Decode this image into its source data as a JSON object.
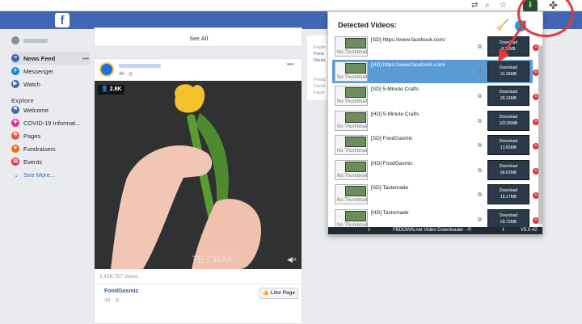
{
  "browser": {
    "ext_icon": "download-arrow-icon",
    "puzzle_icon": "puzzle-icon"
  },
  "facebook": {
    "logo": "f",
    "nav": [
      {
        "label": "News Feed",
        "icon": "newsfeed-icon",
        "color": "#4267b2"
      },
      {
        "label": "Messenger",
        "icon": "messenger-icon",
        "color": "#0084ff"
      },
      {
        "label": "Watch",
        "icon": "watch-icon",
        "color": "#4267b2"
      }
    ],
    "explore_label": "Explore",
    "explore": [
      {
        "label": "Welcome",
        "icon": "flag-icon",
        "color": "#4267b2"
      },
      {
        "label": "COVID-19 Informat...",
        "icon": "covid-icon",
        "color": "#d63384"
      },
      {
        "label": "Pages",
        "icon": "pages-icon",
        "color": "#f5533d"
      },
      {
        "label": "Fundraisers",
        "icon": "fundraisers-icon",
        "color": "#e76f1e"
      },
      {
        "label": "Events",
        "icon": "events-icon",
        "color": "#e41e3f"
      }
    ],
    "see_more": "See More...",
    "see_all": "See All",
    "post_time": "4h",
    "viewers": "2.8K",
    "watermark": "TE CRAF",
    "views": "1,436,757 Views",
    "page_name": "FoodGasmic",
    "page_time": "3d",
    "like_page": "Like Page",
    "right_col": [
      "Englis",
      "Portu",
      "Deuts",
      "Privac",
      "Cooki",
      "Facel"
    ]
  },
  "extension": {
    "title": "Detected Videos:",
    "footer": "FBDOWN.net Video Downloader - ©",
    "version": "V5.0.42",
    "thumb_label": "No Thumbnail",
    "download_label": "Download",
    "videos": [
      {
        "title": "[SD] https://www.facebook.com/",
        "size": "8.22MB",
        "selected": false
      },
      {
        "title": "[HD] https://www.facebook.com/",
        "size": "31.39MB",
        "selected": true
      },
      {
        "title": "[SD] 5-Minute Crafts",
        "size": "28.13MB",
        "selected": false
      },
      {
        "title": "[HD] 5-Minute Crafts",
        "size": "102.85MB",
        "selected": false
      },
      {
        "title": "[SD] FoodGasmic",
        "size": "13.65MB",
        "selected": false
      },
      {
        "title": "[HD] FoodGasmic",
        "size": "68.62MB",
        "selected": false
      },
      {
        "title": "[SD] Tastemade",
        "size": "15.17MB",
        "selected": false
      },
      {
        "title": "[HD] Tastemade",
        "size": "69.73MB",
        "selected": false
      }
    ]
  },
  "colors": {
    "fb_blue": "#4267b2",
    "selected_row": "#5b9bd5",
    "highlight": "#e53935"
  }
}
